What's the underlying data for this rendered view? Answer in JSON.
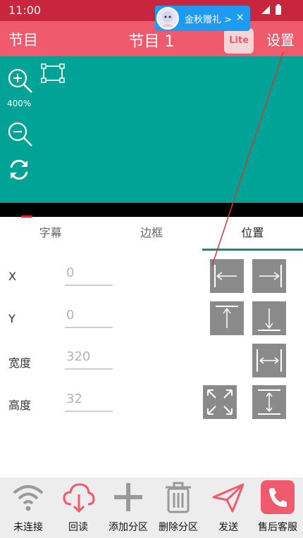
{
  "status_bar": {
    "time": "11:00"
  },
  "promo": {
    "text": "金秋赠礼 >",
    "close": "×"
  },
  "app_bar": {
    "left_label": "节目",
    "title": "节目 1",
    "badge": "Lite",
    "right_label": "设置"
  },
  "preview": {
    "zoom_label": "400%",
    "background_color": "#00a396"
  },
  "tabs": [
    {
      "label": "字幕",
      "active": false
    },
    {
      "label": "边框",
      "active": false
    },
    {
      "label": "位置",
      "active": true
    }
  ],
  "form": {
    "x": {
      "label": "X",
      "value": "0"
    },
    "y": {
      "label": "Y",
      "value": "0"
    },
    "width": {
      "label": "宽度",
      "value": "320"
    },
    "height": {
      "label": "高度",
      "value": "32"
    }
  },
  "bottom_bar": [
    {
      "label": "未连接",
      "icon": "wifi-icon"
    },
    {
      "label": "回读",
      "icon": "cloud-download-icon"
    },
    {
      "label": "添加分区",
      "icon": "plus-icon"
    },
    {
      "label": "删除分区",
      "icon": "trash-icon"
    },
    {
      "label": "发送",
      "icon": "send-icon"
    },
    {
      "label": "售后客服",
      "icon": "phone-icon"
    }
  ],
  "colors": {
    "status_bar": "#c8263f",
    "app_bar": "#f05a6d",
    "accent": "#0f8f84"
  }
}
